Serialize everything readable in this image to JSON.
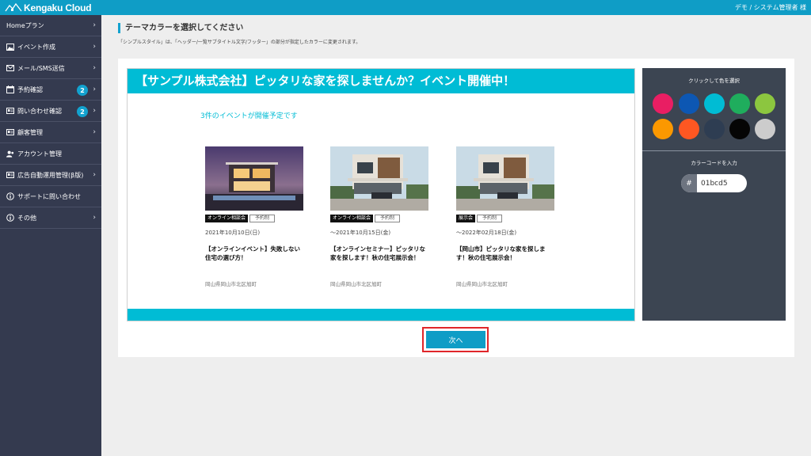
{
  "app": {
    "logo_text": "Kengaku Cloud",
    "user_name": "デモ / システム管理者 様",
    "accent_color": "#0f9dc6"
  },
  "sidebar": {
    "items": [
      {
        "label": "Homeプラン",
        "icon": "home-icon",
        "badge": "",
        "has_chevron": true
      },
      {
        "label": "イベント作成",
        "icon": "image-icon",
        "badge": "",
        "has_chevron": true
      },
      {
        "label": "メール/SMS送信",
        "icon": "mail-icon",
        "badge": "",
        "has_chevron": true
      },
      {
        "label": "予約確認",
        "icon": "calendar-icon",
        "badge": "2",
        "has_chevron": true
      },
      {
        "label": "問い合わせ確認",
        "icon": "id-card-icon",
        "badge": "2",
        "has_chevron": true
      },
      {
        "label": "顧客管理",
        "icon": "id-card-icon",
        "badge": "",
        "has_chevron": true
      },
      {
        "label": "アカウント管理",
        "icon": "users-icon",
        "badge": "",
        "has_chevron": false
      },
      {
        "label": "広告自動運用管理(β版)",
        "icon": "id-card-icon",
        "badge": "",
        "has_chevron": true
      },
      {
        "label": "サポートに問い合わせ",
        "icon": "info-icon",
        "badge": "",
        "has_chevron": false
      },
      {
        "label": "その他",
        "icon": "info-icon",
        "badge": "",
        "has_chevron": true
      }
    ]
  },
  "main": {
    "title": "テーマカラーを選択してください",
    "description": "「シンプルスタイル」は、「ヘッダー/一覧サブタイトル文字/フッター」の部分が指定したカラーに変更されます。"
  },
  "preview": {
    "header_title": "【サンプル株式会社】ピッタリな家を探しませんか？イベント開催中！",
    "subtitle": "3件のイベントが開催予定です",
    "theme_color": "#00bcd5",
    "events": [
      {
        "tag": "オンライン相談会",
        "reservation": "予約制",
        "date": "2021年10月10日(日)",
        "title": "【オンラインイベント】失敗しない住宅の選び方！",
        "location": "岡山県岡山市北区旭町",
        "image": "night-modern-house"
      },
      {
        "tag": "オンライン相談会",
        "reservation": "予約制",
        "date": "～2021年10月15日(金)",
        "title": "【オンラインセミナー】ピッタリな家を探します！秋の住宅展示会！",
        "location": "岡山県岡山市北区旭町",
        "image": "day-modern-house"
      },
      {
        "tag": "展示会",
        "reservation": "予約制",
        "date": "～2022年02月18日(金)",
        "title": "【岡山市】ピッタリな家を探します！秋の住宅展示会！",
        "location": "岡山県岡山市北区旭町",
        "image": "day-modern-house"
      }
    ]
  },
  "color_picker": {
    "title": "クリックして色を選択",
    "swatches": [
      "#e91e63",
      "#0d57b3",
      "#00bcd4",
      "#1fad5d",
      "#8cc63f",
      "#fb9800",
      "#fe5722",
      "#2e3d52",
      "#050505",
      "#cccccc"
    ],
    "code_title": "カラーコードを入力",
    "hash": "#",
    "code_value": "01bcd5"
  },
  "next_button": {
    "label": "次へ"
  }
}
